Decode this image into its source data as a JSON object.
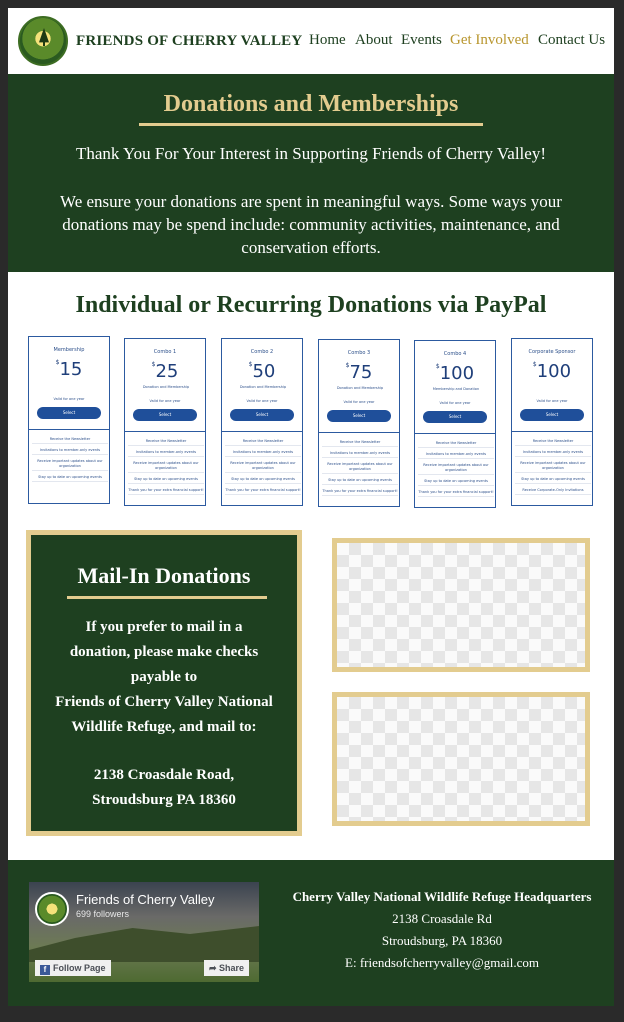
{
  "header": {
    "brand": "FRIENDS OF CHERRY VALLEY",
    "nav": [
      "Home",
      "About",
      "Events",
      "Get Involved",
      "Contact Us"
    ],
    "active_nav": "Get Involved"
  },
  "hero": {
    "title": "Donations and Memberships",
    "line1": "Thank You For Your Interest in Supporting Friends of Cherry Valley!",
    "line2": "We ensure your donations are spent in meaningful ways. Some ways your donations may be spend include: community activities, maintenance, and conservation efforts."
  },
  "paypal": {
    "title": "Individual or Recurring Donations via PayPal",
    "cards": [
      {
        "name": "Membership",
        "price": "15",
        "desc": "",
        "note": "Valid for one year",
        "button": "Select",
        "benefits": [
          "Receive the Newsletter",
          "Invitations to member-only events",
          "Receive important updates about our organization",
          "Stay up to date on upcoming events"
        ]
      },
      {
        "name": "Combo 1",
        "price": "25",
        "desc": "Donation and Membership",
        "note": "Valid for one year",
        "button": "Select",
        "benefits": [
          "Receive the Newsletter",
          "Invitations to member-only events",
          "Receive important updates about our organization",
          "Stay up to date on upcoming events",
          "Thank you for your extra financial support!"
        ]
      },
      {
        "name": "Combo 2",
        "price": "50",
        "desc": "Donation and Membership",
        "note": "Valid for one year",
        "button": "Select",
        "benefits": [
          "Receive the Newsletter",
          "Invitations to member-only events",
          "Receive important updates about our organization",
          "Stay up to date on upcoming events",
          "Thank you for your extra financial support!"
        ]
      },
      {
        "name": "Combo 3",
        "price": "75",
        "desc": "Donation and Membership",
        "note": "Valid for one year",
        "button": "Select",
        "benefits": [
          "Receive the Newsletter",
          "Invitations to member-only events",
          "Receive important updates about our organization",
          "Stay up to date on upcoming events",
          "Thank you for your extra financial support!"
        ]
      },
      {
        "name": "Combo 4",
        "price": "100",
        "desc": "Membership and Donation",
        "note": "Valid for one year",
        "button": "Select",
        "benefits": [
          "Receive the Newsletter",
          "Invitations to member-only events",
          "Receive important updates about our organization",
          "Stay up to date on upcoming events",
          "Thank you for your extra financial support!"
        ]
      },
      {
        "name": "Corporate Sponsor",
        "price": "100",
        "desc": "",
        "note": "Valid for one year",
        "button": "Select",
        "benefits": [
          "Receive the Newsletter",
          "Invitations to member-only events",
          "Receive important updates about our organization",
          "Stay up to date on upcoming events",
          "Receive Corporate-Only Invitations"
        ]
      }
    ]
  },
  "mail": {
    "title": "Mail-In Donations",
    "body_lines": [
      "If you prefer to mail in a",
      "donation, please make checks",
      "payable to",
      "Friends of Cherry Valley National",
      "Wildlife Refuge, and mail to:"
    ],
    "address_lines": [
      "2138 Croasdale Road,",
      "Stroudsburg PA 18360"
    ]
  },
  "footer": {
    "fb_page": "Friends of Cherry Valley",
    "fb_followers": "699 followers",
    "fb_follow": "Follow Page",
    "fb_share": "Share",
    "hq": "Cherry Valley National Wildlife Refuge Headquarters",
    "street": "2138 Croasdale Rd",
    "city": "Stroudsburg, PA 18360",
    "email": "E: friendsofcherryvalley@gmail.com"
  }
}
